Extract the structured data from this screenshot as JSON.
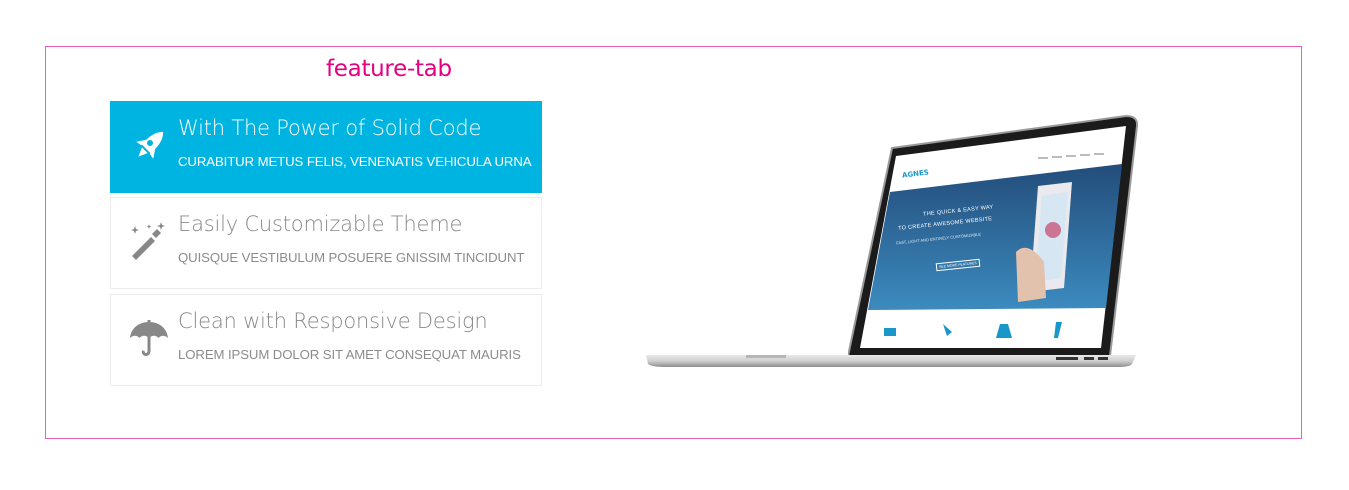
{
  "frame": {
    "label": "feature-tab",
    "color": "#e5007f"
  },
  "tabs": [
    {
      "title": "With The Power of Solid Code",
      "subtitle": "CURABITUR METUS FELIS, VENENATIS VEHICULA URNA",
      "icon": "rocket-icon",
      "active": true
    },
    {
      "title": "Easily Customizable Theme",
      "subtitle": "QUISQUE VESTIBULUM POSUERE GNISSIM TINCIDUNT",
      "icon": "magic-wand-icon",
      "active": false
    },
    {
      "title": "Clean with Responsive Design",
      "subtitle": "LOREM IPSUM DOLOR SIT AMET CONSEQUAT MAURIS",
      "icon": "umbrella-icon",
      "active": false
    }
  ],
  "screen": {
    "logo": "AGNES",
    "hero_line1": "THE QUICK & EASY WAY",
    "hero_line2": "TO CREATE AWESOME WEBSITE",
    "hero_line3": "FAST, LIGHT AND ENTIRELY CUSTOMIZABLE",
    "cta": "SEE MORE FEATURES"
  },
  "colors": {
    "accent": "#00b4e1",
    "icon_gray": "#888888"
  }
}
